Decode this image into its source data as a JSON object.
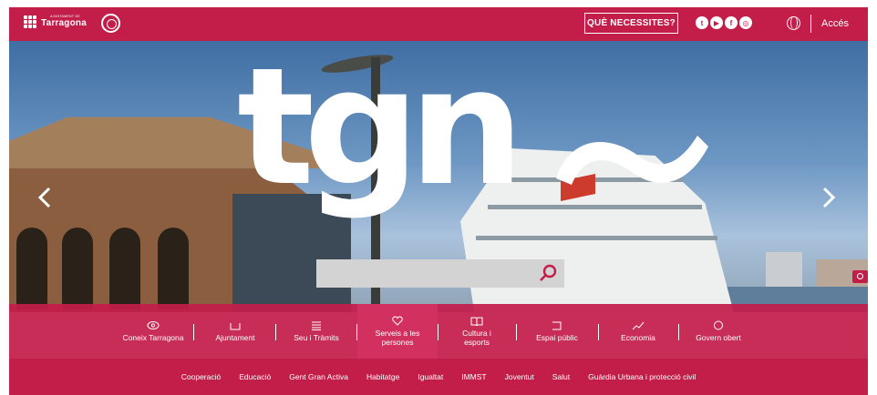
{
  "colors": {
    "brand": "#c31d4a",
    "active_tab": "#d2305f",
    "search_bg": "#d3d3d3"
  },
  "header": {
    "logo_small": "AJUNTAMENT DE",
    "logo_name": "Tarragona",
    "need_button": "QUÈ NECESSITES?",
    "social_icons": [
      "twitter-icon",
      "youtube-icon",
      "facebook-icon",
      "instagram-icon"
    ],
    "access_label": "Accés"
  },
  "hero": {
    "headline": "tgn",
    "search_placeholder": ""
  },
  "categories": [
    {
      "label": "Coneix Tarragona",
      "icon": "eye-icon"
    },
    {
      "label": "Ajuntament",
      "icon": "building-icon"
    },
    {
      "label": "Seu i Tràmits",
      "icon": "list-icon"
    },
    {
      "label": "Serveis a les persones",
      "icon": "heart-icon",
      "active": true
    },
    {
      "label": "Cultura i esports",
      "icon": "book-icon"
    },
    {
      "label": "Espai públic",
      "icon": "frame-icon"
    },
    {
      "label": "Economia",
      "icon": "chart-icon"
    },
    {
      "label": "Govern obert",
      "icon": "circle-icon"
    }
  ],
  "subnav": [
    "Cooperació",
    "Educació",
    "Gent Gran Activa",
    "Habitatge",
    "Igualtat",
    "IMMST",
    "Joventut",
    "Salut",
    "Guàrdia Urbana i protecció civil"
  ]
}
